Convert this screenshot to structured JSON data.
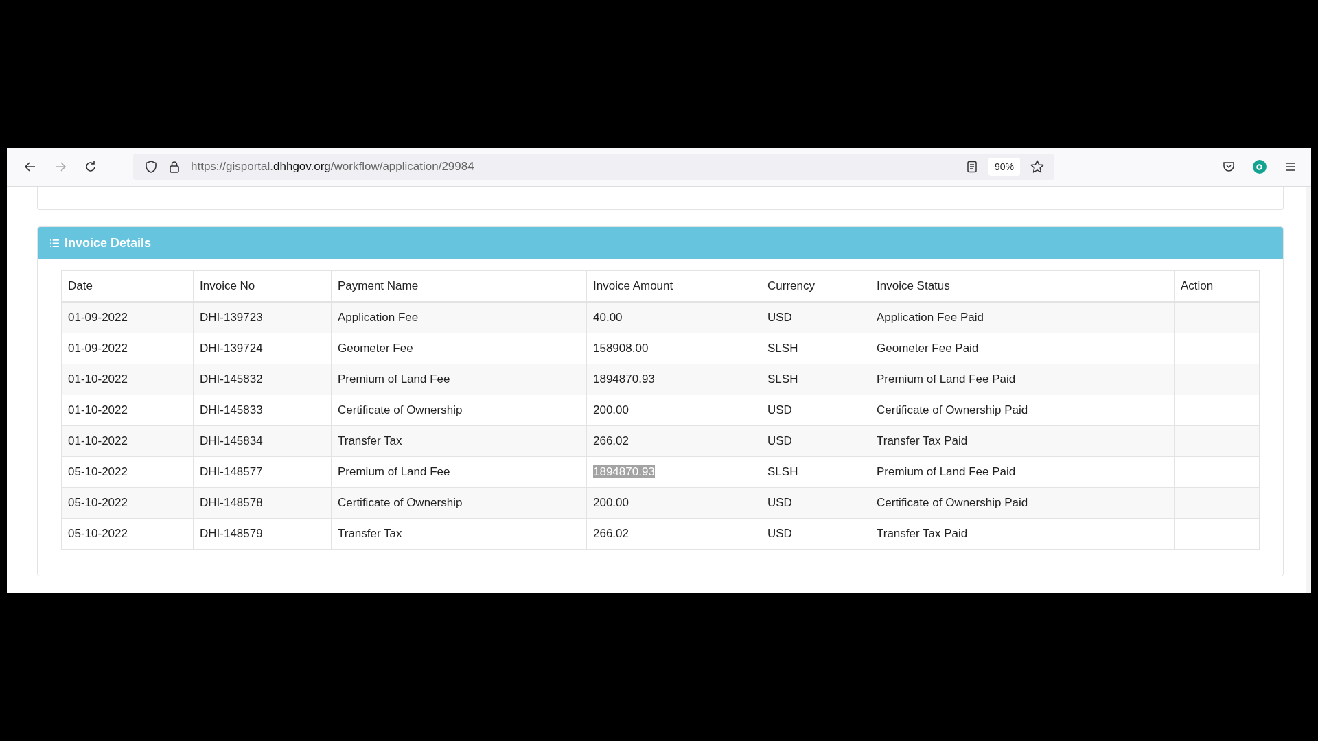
{
  "browser": {
    "url_prefix": "https://gisportal.",
    "url_domain": "dhhgov.org",
    "url_path": "/workflow/application/29984",
    "zoom": "90%"
  },
  "invoice_panel": {
    "title": "Invoice Details",
    "columns": [
      "Date",
      "Invoice No",
      "Payment Name",
      "Invoice Amount",
      "Currency",
      "Invoice Status",
      "Action"
    ],
    "rows": [
      {
        "date": "01-09-2022",
        "invoice_no": "DHI-139723",
        "payment_name": "Application Fee",
        "amount": "40.00",
        "currency": "USD",
        "status": "Application Fee Paid",
        "amount_selected": false
      },
      {
        "date": "01-09-2022",
        "invoice_no": "DHI-139724",
        "payment_name": "Geometer Fee",
        "amount": "158908.00",
        "currency": "SLSH",
        "status": "Geometer Fee Paid",
        "amount_selected": false
      },
      {
        "date": "01-10-2022",
        "invoice_no": "DHI-145832",
        "payment_name": "Premium of Land Fee",
        "amount": "1894870.93",
        "currency": "SLSH",
        "status": "Premium of Land Fee Paid",
        "amount_selected": false
      },
      {
        "date": "01-10-2022",
        "invoice_no": "DHI-145833",
        "payment_name": "Certificate of Ownership",
        "amount": "200.00",
        "currency": "USD",
        "status": "Certificate of Ownership Paid",
        "amount_selected": false
      },
      {
        "date": "01-10-2022",
        "invoice_no": "DHI-145834",
        "payment_name": "Transfer Tax",
        "amount": "266.02",
        "currency": "USD",
        "status": "Transfer Tax Paid",
        "amount_selected": false
      },
      {
        "date": "05-10-2022",
        "invoice_no": "DHI-148577",
        "payment_name": "Premium of Land Fee",
        "amount": "1894870.93",
        "currency": "SLSH",
        "status": "Premium of Land Fee Paid",
        "amount_selected": true
      },
      {
        "date": "05-10-2022",
        "invoice_no": "DHI-148578",
        "payment_name": "Certificate of Ownership",
        "amount": "200.00",
        "currency": "USD",
        "status": "Certificate of Ownership Paid",
        "amount_selected": false
      },
      {
        "date": "05-10-2022",
        "invoice_no": "DHI-148579",
        "payment_name": "Transfer Tax",
        "amount": "266.02",
        "currency": "USD",
        "status": "Transfer Tax Paid",
        "amount_selected": false
      }
    ]
  }
}
